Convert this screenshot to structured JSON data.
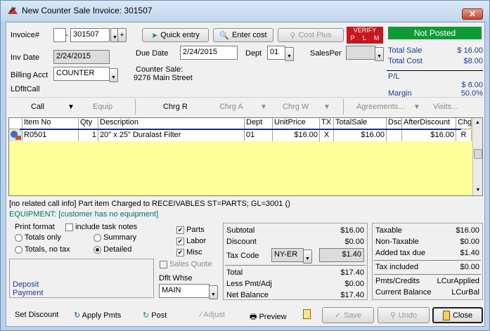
{
  "window": {
    "title": "New Counter Sale Invoice: 301507"
  },
  "header": {
    "invoice_label": "Invoice#",
    "invoice_prefix": "",
    "invoice_dash": "-",
    "invoice_number": "301507",
    "inv_date_label": "Inv Date",
    "inv_date": "2/24/2015",
    "billing_label": "Billing Acct",
    "billing_acct": "COUNTER",
    "ldftcall_label": "LDfltCall",
    "due_date_label": "Due Date",
    "due_date": "2/24/2015",
    "dept_label": "Dept",
    "dept_value": "01",
    "salesper_label": "SalesPer",
    "salesper_value": "",
    "counter_sale_label": "Counter Sale:",
    "counter_sale_address": "9276 Main Street"
  },
  "toolbar": {
    "quick_entry": "Quick entry",
    "enter_cost": "Enter cost",
    "cost_plus": "Cost Plus"
  },
  "verify": {
    "title": "VERIFY",
    "p": "P",
    "l": "L",
    "m": "M"
  },
  "status": {
    "text": "Not Posted",
    "color": "#0d9b35"
  },
  "totals_top": {
    "total_sale_label": "Total Sale",
    "total_sale": "$ 16.00",
    "total_cost_label": "Total Cost",
    "total_cost": "$8.00",
    "pl_label": "P/L",
    "pl": "$ 8.00",
    "margin_label": "Margin",
    "margin": "50.0%"
  },
  "menu_tabs": {
    "call": "Call",
    "equip": "Equip",
    "chrg_r": "Chrg R",
    "chrg_a": "Chrg A",
    "chrg_w": "Chrg W",
    "agreements": "Agreements...",
    "visits": "Visits..."
  },
  "table": {
    "columns": [
      "Item No",
      "Qty",
      "Description",
      "Dept",
      "UnitPrice",
      "TX",
      "TotalSale",
      "Dsc",
      "AfterDiscount",
      "Chg"
    ],
    "rows": [
      {
        "item_no": "R0501",
        "qty": "1",
        "description": "20\" x 25\" Duralast Filter",
        "dept": "01",
        "unit_price": "$16.00",
        "tx": "X",
        "total_sale": "$16.00",
        "dsc": "",
        "after_discount": "$16.00",
        "chg": "R"
      }
    ]
  },
  "info": {
    "line1": "[no related call info]   Part item Charged to RECEIVABLES ST=PARTS; GL=3001 ()",
    "equipment": "EQUIPMENT: [customer has no equipment]"
  },
  "print": {
    "print_format_label": "Print format",
    "include_task_notes": "include task notes",
    "totals_only": "Totals only",
    "summary": "Summary",
    "totals_no_tax": "Totals, no tax",
    "detailed": "Detailed",
    "parts": "Parts",
    "labor": "Labor",
    "misc": "Misc",
    "sales_quote": "Sales Quote"
  },
  "deposit": {
    "deposit": "Deposit",
    "payment": "Payment"
  },
  "whse": {
    "label": "Dflt Whse",
    "value": "MAIN"
  },
  "summary": {
    "subtotal_label": "Subtotal",
    "subtotal": "$16.00",
    "discount_label": "Discount",
    "discount": "$0.00",
    "tax_code_label": "Tax Code",
    "tax_code": "NY-ER",
    "tax_amount": "$1.40",
    "total_label": "Total",
    "total": "$17.40",
    "less_pmt_label": "Less Pmt/Adj",
    "less_pmt": "$0.00",
    "net_balance_label": "Net Balance",
    "net_balance": "$17.40"
  },
  "tax": {
    "taxable_label": "Taxable",
    "taxable": "$16.00",
    "non_taxable_label": "Non-Taxable",
    "non_taxable": "$0.00",
    "added_tax_label": "Added tax due",
    "added_tax": "$1.40",
    "tax_included_label": "Tax included",
    "tax_included": "$0.00",
    "pmts_label": "Pmts/Credits",
    "pmts": "LCurApplied",
    "current_balance_label": "Current Balance",
    "current_balance": "LCurBal"
  },
  "footer": {
    "set_discount": "Set Discount",
    "apply_pmts": "Apply Pmts",
    "post": "Post",
    "adjust": "Adjust",
    "preview": "Preview",
    "save": "Save",
    "undo": "Undo",
    "close": "Close"
  }
}
